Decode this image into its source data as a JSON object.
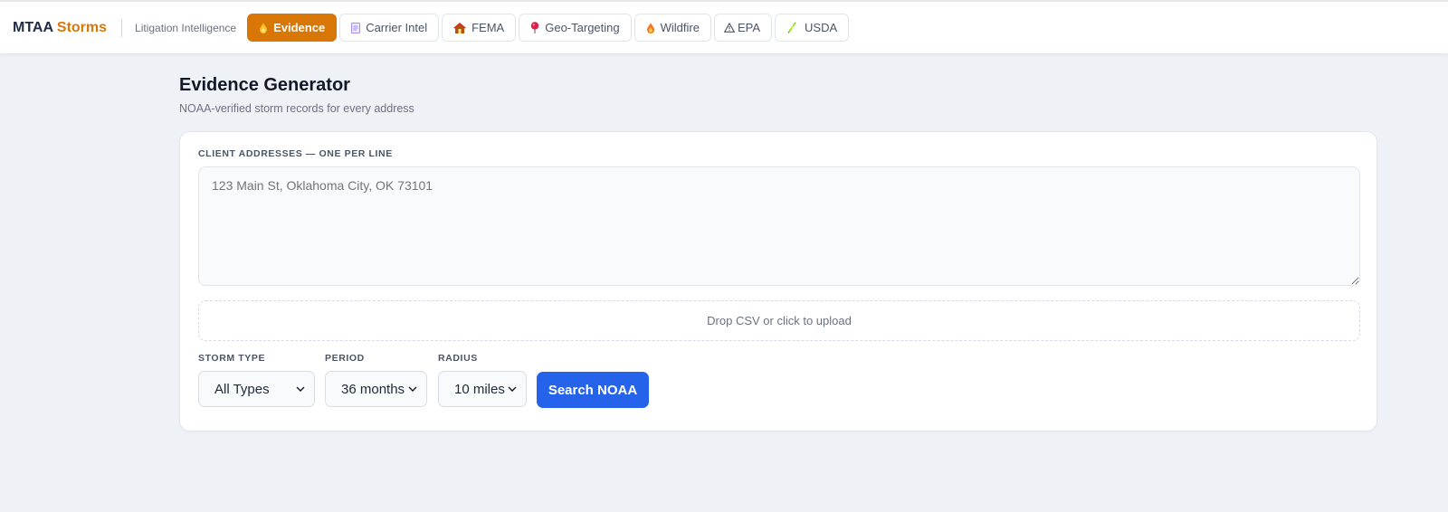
{
  "header": {
    "brand_primary": "MTAA",
    "brand_accent": "Storms",
    "subtitle": "Litigation Intelligence",
    "tabs": [
      {
        "label": "Evidence",
        "icon": "flame-drop-icon",
        "active": true
      },
      {
        "label": "Carrier Intel",
        "icon": "document-icon",
        "active": false
      },
      {
        "label": "FEMA",
        "icon": "house-icon",
        "active": false
      },
      {
        "label": "Geo-Targeting",
        "icon": "pin-icon",
        "active": false
      },
      {
        "label": "Wildfire",
        "icon": "fire-icon",
        "active": false
      },
      {
        "label": "EPA",
        "icon": "warning-icon",
        "active": false
      },
      {
        "label": "USDA",
        "icon": "wheat-icon",
        "active": false
      }
    ]
  },
  "main": {
    "title": "Evidence Generator",
    "subtitle": "NOAA-verified storm records for every address",
    "addresses_label": "CLIENT ADDRESSES — ONE PER LINE",
    "addresses_placeholder": "123 Main St, Oklahoma City, OK 73101",
    "upload_text": "Drop CSV or click to upload",
    "storm_type": {
      "label": "STORM TYPE",
      "value": "All Types"
    },
    "period": {
      "label": "PERIOD",
      "value": "36 months"
    },
    "radius": {
      "label": "RADIUS",
      "value": "10 miles"
    },
    "search_button": "Search NOAA"
  },
  "colors": {
    "accent": "#d97706",
    "primary_button": "#2563eb",
    "background": "#eef1f6"
  }
}
